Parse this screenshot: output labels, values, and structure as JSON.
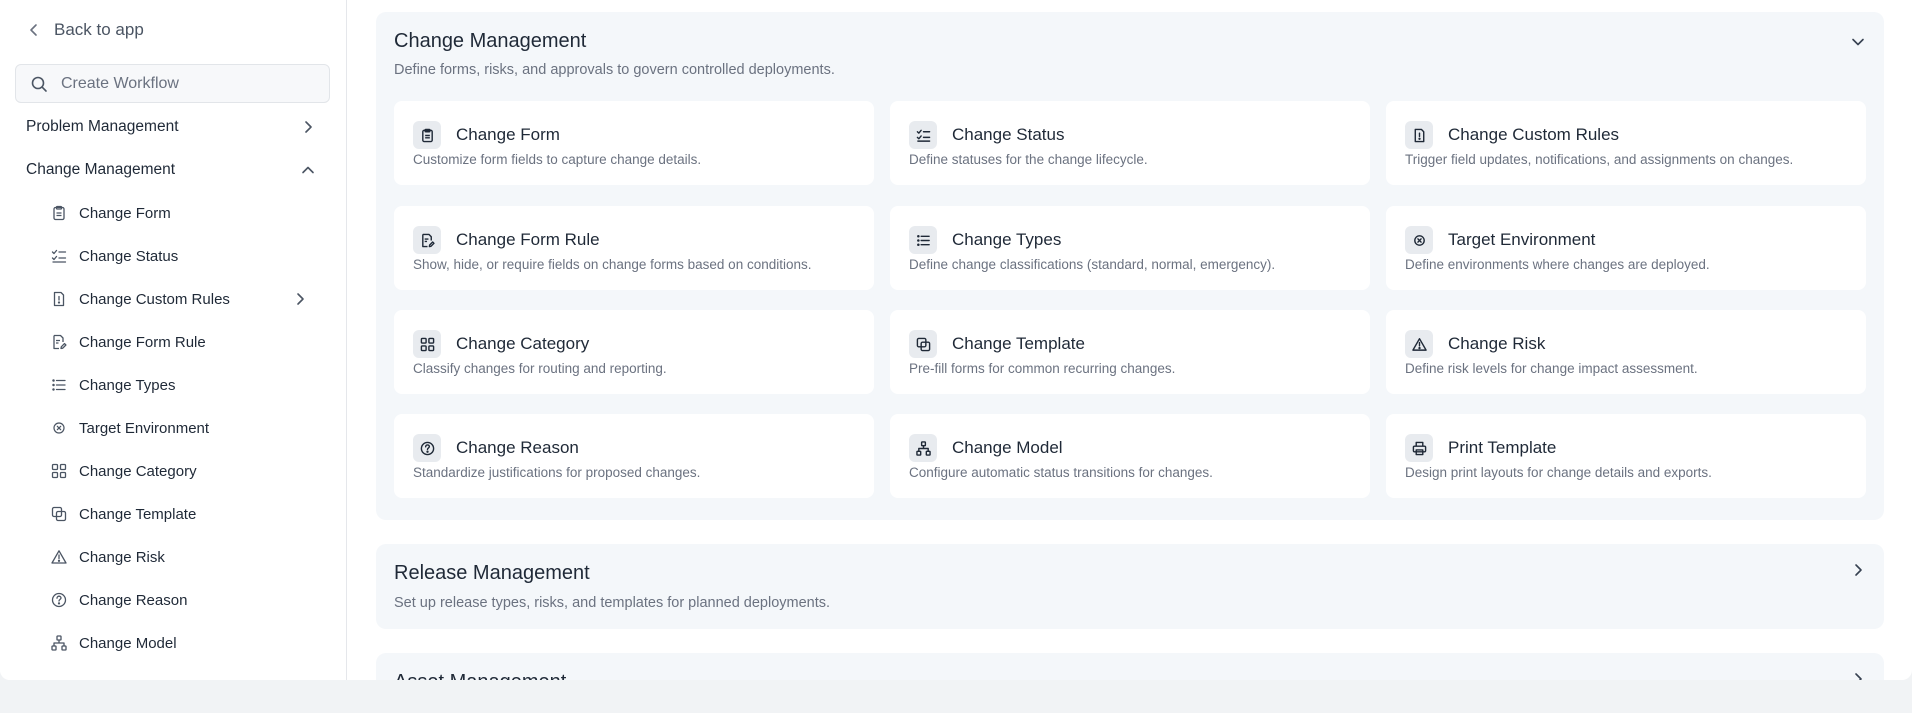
{
  "sidebar": {
    "back_label": "Back to app",
    "search_placeholder": "Create Workflow",
    "groups": [
      {
        "label": "Problem Management",
        "expanded": false
      },
      {
        "label": "Change Management",
        "expanded": true
      }
    ],
    "items": [
      {
        "label": "Change Form",
        "icon": "clipboard-icon"
      },
      {
        "label": "Change Status",
        "icon": "checklist-icon"
      },
      {
        "label": "Change Custom Rules",
        "icon": "file-alert-icon",
        "has_children": true
      },
      {
        "label": "Change Form Rule",
        "icon": "file-edit-icon"
      },
      {
        "label": "Change Types",
        "icon": "list-icon"
      },
      {
        "label": "Target Environment",
        "icon": "target-icon"
      },
      {
        "label": "Change Category",
        "icon": "grid-icon"
      },
      {
        "label": "Change Template",
        "icon": "copy-icon"
      },
      {
        "label": "Change Risk",
        "icon": "warning-icon"
      },
      {
        "label": "Change Reason",
        "icon": "help-circle-icon"
      },
      {
        "label": "Change Model",
        "icon": "network-icon"
      }
    ]
  },
  "sections": {
    "change": {
      "title": "Change Management",
      "description": "Define forms, risks, and approvals to govern controlled deployments.",
      "expanded": true,
      "cards": [
        {
          "title": "Change Form",
          "description": "Customize form fields to capture change details.",
          "icon": "clipboard-icon"
        },
        {
          "title": "Change Status",
          "description": "Define statuses for the change lifecycle.",
          "icon": "checklist-icon"
        },
        {
          "title": "Change Custom Rules",
          "description": "Trigger field updates, notifications, and assignments on changes.",
          "icon": "file-alert-icon"
        },
        {
          "title": "Change Form Rule",
          "description": "Show, hide, or require fields on change forms based on conditions.",
          "icon": "file-edit-icon"
        },
        {
          "title": "Change Types",
          "description": "Define change classifications (standard, normal, emergency).",
          "icon": "list-icon"
        },
        {
          "title": "Target Environment",
          "description": "Define environments where changes are deployed.",
          "icon": "target-icon"
        },
        {
          "title": "Change Category",
          "description": "Classify changes for routing and reporting.",
          "icon": "grid-icon"
        },
        {
          "title": "Change Template",
          "description": "Pre-fill forms for common recurring changes.",
          "icon": "copy-icon"
        },
        {
          "title": "Change Risk",
          "description": "Define risk levels for change impact assessment.",
          "icon": "warning-icon"
        },
        {
          "title": "Change Reason",
          "description": "Standardize justifications for proposed changes.",
          "icon": "help-circle-icon"
        },
        {
          "title": "Change Model",
          "description": "Configure automatic status transitions for changes.",
          "icon": "network-icon"
        },
        {
          "title": "Print Template",
          "description": "Design print layouts for change details and exports.",
          "icon": "printer-icon"
        }
      ]
    },
    "release": {
      "title": "Release Management",
      "description": "Set up release types, risks, and templates for planned deployments.",
      "expanded": false
    },
    "asset": {
      "title": "Asset Management",
      "expanded": false
    }
  }
}
